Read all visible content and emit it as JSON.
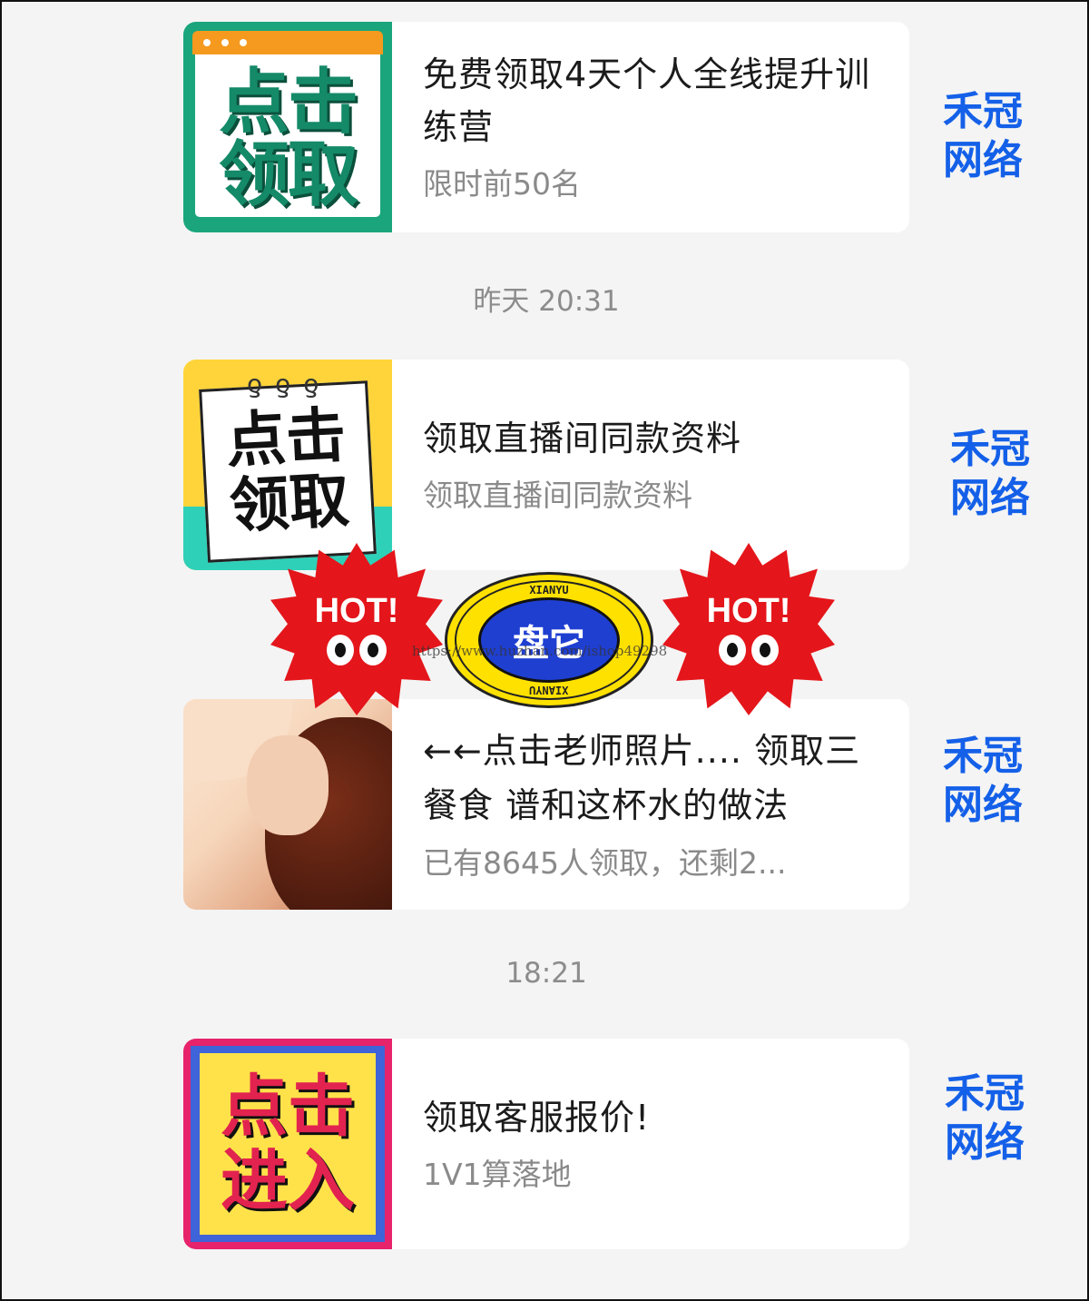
{
  "messages": [
    {
      "thumb_text": [
        "点击",
        "领取"
      ],
      "title": "免费领取4天个人全线提升训练营",
      "subtitle": "限时前50名",
      "brand": [
        "禾冠",
        "网络"
      ]
    },
    {
      "thumb_text": [
        "点击",
        "领取"
      ],
      "title": "领取直播间同款资料",
      "subtitle": "领取直播间同款资料",
      "brand": [
        "禾冠",
        "网络"
      ]
    },
    {
      "title": "←←点击老师照片.... 领取三餐食 谱和这杯水的做法",
      "subtitle": "已有8645人领取，还剩2...",
      "brand": [
        "禾冠",
        "网络"
      ]
    },
    {
      "thumb_text": [
        "点击",
        "进入"
      ],
      "title": "领取客服报价!",
      "subtitle": "1V1算落地",
      "brand": [
        "禾冠",
        "网络"
      ]
    }
  ],
  "timestamps": [
    "昨天 20:31",
    "18:21"
  ],
  "overlay": {
    "hot_label": "HOT!",
    "logo_text": "盘它",
    "logo_ring_text": "XIANYU",
    "watermark": "https://www.huzhan.com/ishop49298"
  },
  "colors": {
    "brand": "#1460e8",
    "hot": "#e4161b",
    "logo_yellow": "#ffe100",
    "logo_blue": "#1f3fd1"
  }
}
